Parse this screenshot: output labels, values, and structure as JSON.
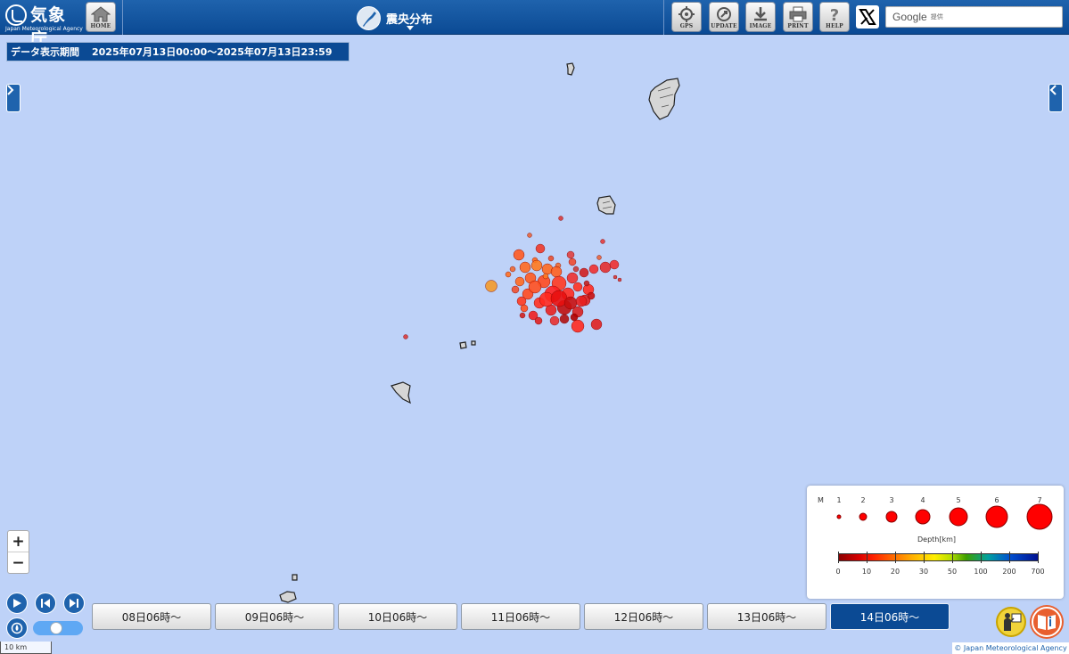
{
  "header": {
    "agency_name": "気象庁",
    "agency_name_en": "Japan Meteorological Agency",
    "home_label": "HOME",
    "title": "震央分布",
    "tools": [
      {
        "label": "GPS",
        "icon": "gps-icon"
      },
      {
        "label": "UPDATE",
        "icon": "update-icon"
      },
      {
        "label": "IMAGE",
        "icon": "download-icon"
      },
      {
        "label": "PRINT",
        "icon": "print-icon"
      },
      {
        "label": "HELP",
        "icon": "help-icon"
      }
    ],
    "search_brand": "Google",
    "search_note": "提供"
  },
  "period": {
    "label": "データ表示期間",
    "value": "2025年07月13日00:00～2025年07月13日23:59"
  },
  "legend": {
    "mag_title": "M",
    "magnitudes": [
      "1",
      "2",
      "3",
      "4",
      "5",
      "6",
      "7"
    ],
    "depth_title": "Depth[km]",
    "depth_ticks": [
      "0",
      "10",
      "20",
      "30",
      "50",
      "100",
      "200",
      "700"
    ],
    "magnitude_color": "#ff0000"
  },
  "timeline": {
    "days": [
      "08日06時～",
      "09日06時～",
      "10日06時～",
      "11日06時～",
      "12日06時～",
      "13日06時～",
      "14日06時～"
    ],
    "active": "14日06時～"
  },
  "scale": "10 km",
  "credit": "© Japan Meteorological Agency",
  "colors": {
    "header_blue": "#0b4a94",
    "sea": "#bed2f8",
    "land": "#d6d6d6"
  }
}
